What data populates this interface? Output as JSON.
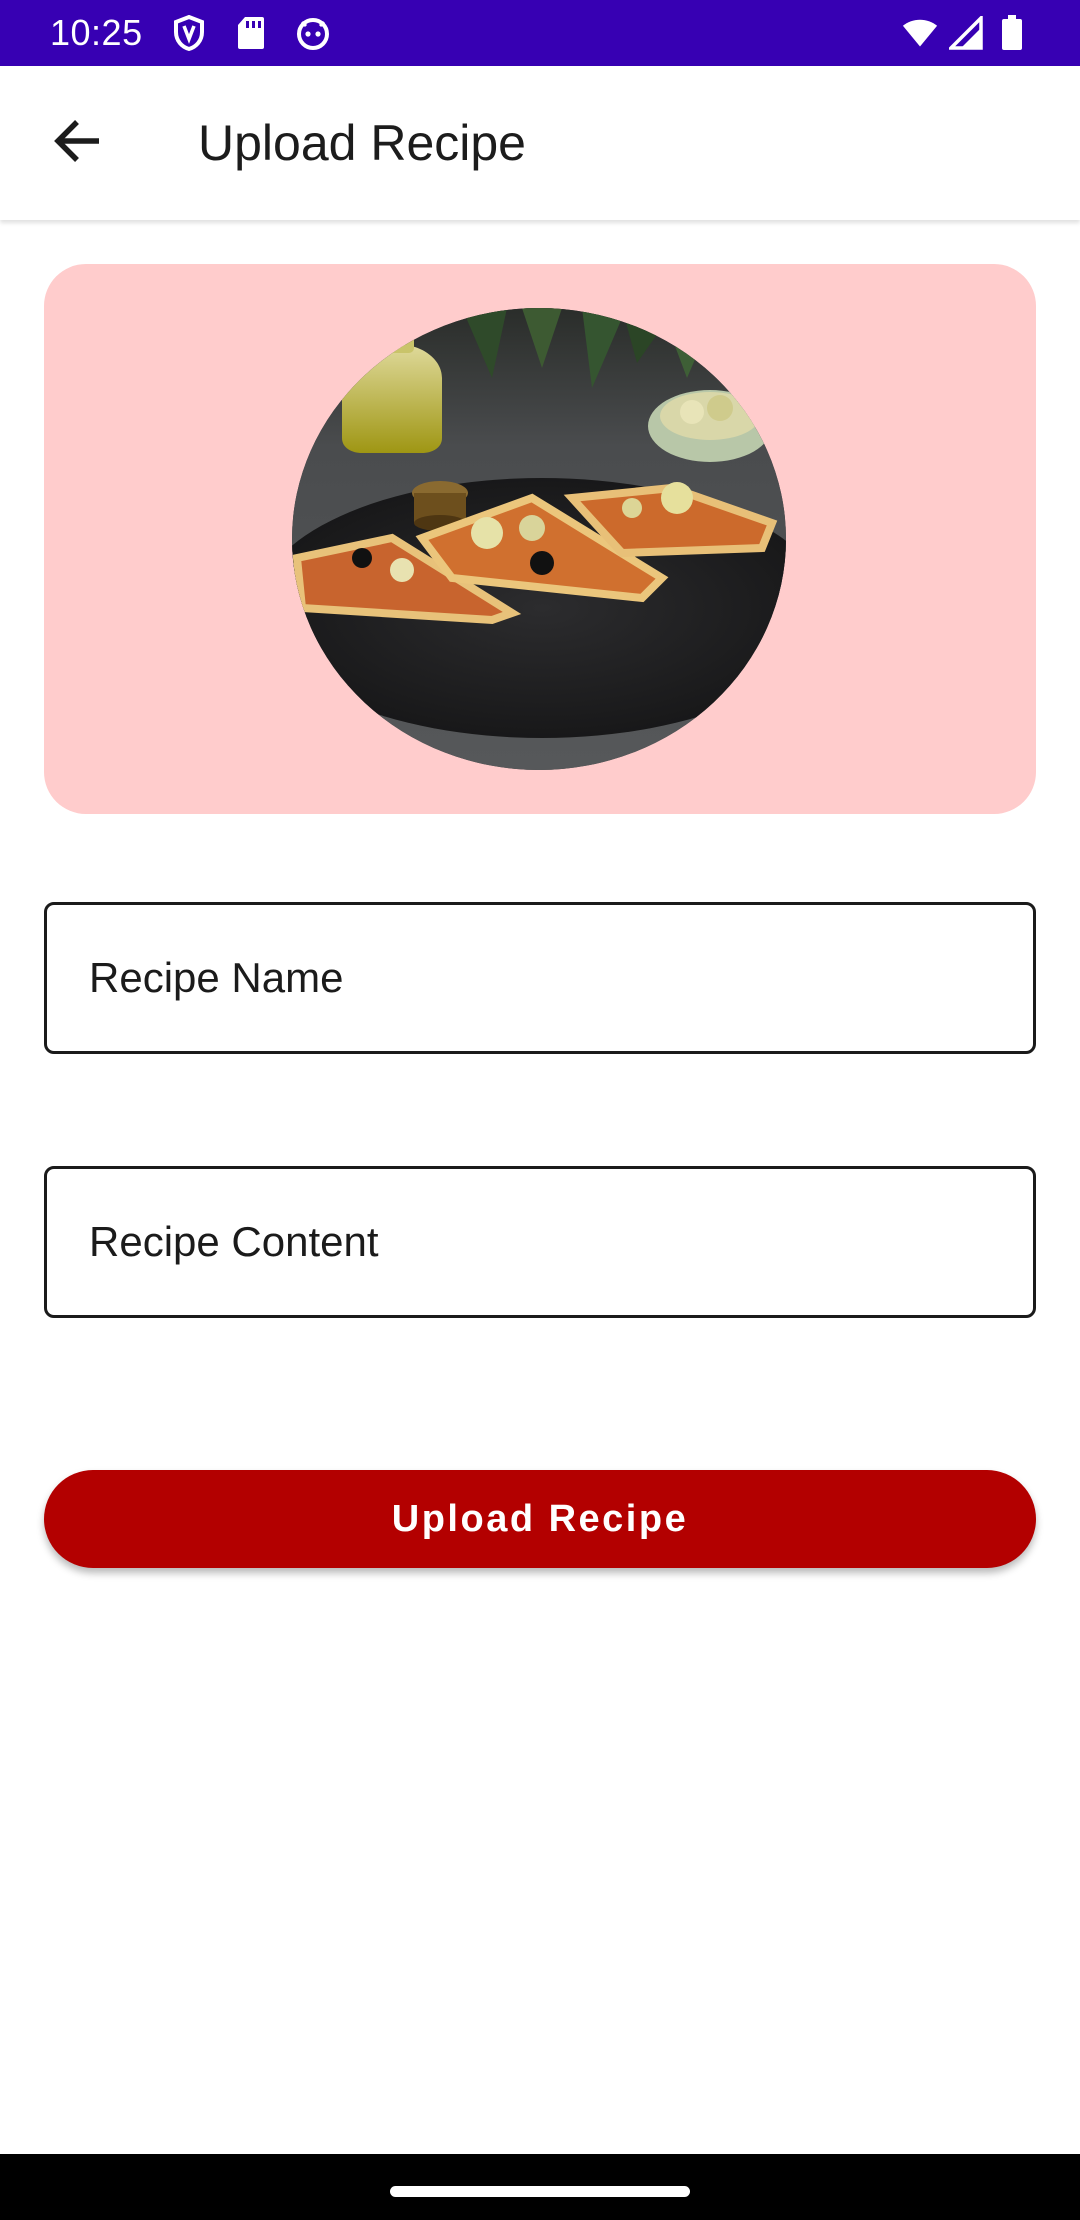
{
  "status_bar": {
    "time": "10:25",
    "left_icons": [
      "shield-icon",
      "sd-card-icon",
      "android-face-icon"
    ],
    "right_icons": [
      "wifi-icon",
      "signal-icon",
      "battery-icon"
    ],
    "background_color": "#3700b3"
  },
  "app_bar": {
    "back_icon": "arrow-back-icon",
    "title": "Upload Recipe"
  },
  "image_card": {
    "background_color": "#ffcccc",
    "image_subject": "pizza-slices-on-slate-plate"
  },
  "form": {
    "recipe_name_placeholder": "Recipe Name",
    "recipe_content_placeholder": "Recipe Content"
  },
  "actions": {
    "upload_label": "Upload Recipe",
    "upload_color": "#b30000"
  }
}
